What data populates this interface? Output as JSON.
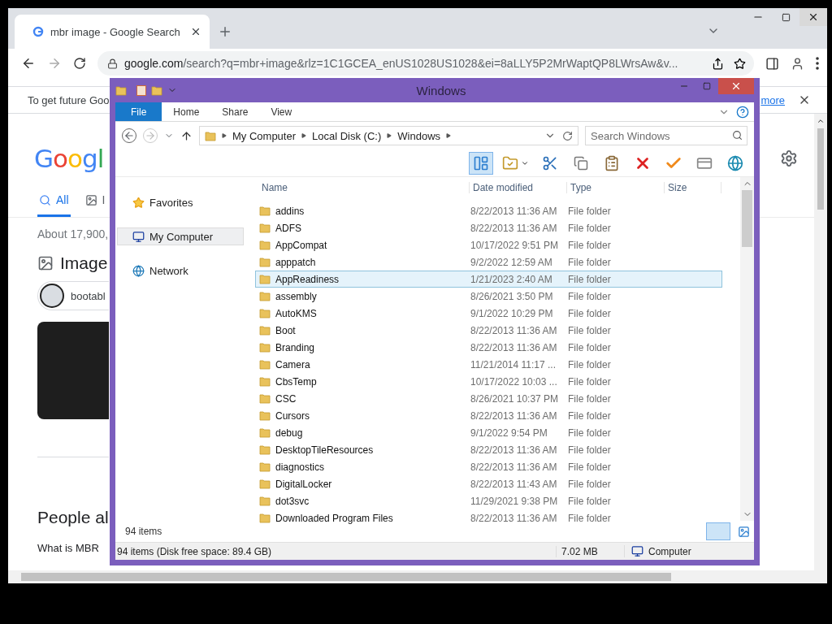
{
  "browser": {
    "tabs": [
      {
        "title": "mbr image - Google Search",
        "selected": true
      }
    ],
    "url": {
      "host": "google.com",
      "path": "/search?q=mbr+image&rlz=1C1GCEA_enUS1028US1028&ei=8aLLY5P2MrWaptQP8LWrsAw&v..."
    },
    "infobar": {
      "text": "To get future Goo",
      "link": "more"
    },
    "page": {
      "logo": "Googl",
      "tabs": [
        {
          "label": "All",
          "kind": "all",
          "selected": true
        },
        {
          "label": "I",
          "kind": "images",
          "selected": false
        }
      ],
      "result_stats": "About 17,900,",
      "images_heading": "Image",
      "chip": "bootabl",
      "people_heading": "People al",
      "question": "What is MBR"
    }
  },
  "explorer": {
    "title": "Windows",
    "ribbon_tabs": [
      {
        "label": "File",
        "kind": "menu"
      },
      {
        "label": "Home",
        "kind": "tab"
      },
      {
        "label": "Share",
        "kind": "tab"
      },
      {
        "label": "View",
        "kind": "tab"
      }
    ],
    "breadcrumb": [
      "My Computer",
      "Local Disk (C:)",
      "Windows"
    ],
    "search": {
      "placeholder": "Search Windows"
    },
    "nav": [
      {
        "label": "Favorites",
        "kind": "favorites",
        "selected": false
      },
      {
        "label": "My Computer",
        "kind": "computer",
        "selected": true
      },
      {
        "label": "Network",
        "kind": "network",
        "selected": false
      }
    ],
    "nav_count": "94 items",
    "columns": [
      "Name",
      "Date modified",
      "Type",
      "Size"
    ],
    "rows": [
      {
        "name": "addins",
        "date": "8/22/2013 11:36 AM",
        "type": "File folder",
        "selected": false
      },
      {
        "name": "ADFS",
        "date": "8/22/2013 11:36 AM",
        "type": "File folder",
        "selected": false
      },
      {
        "name": "AppCompat",
        "date": "10/17/2022 9:51 PM",
        "type": "File folder",
        "selected": false
      },
      {
        "name": "apppatch",
        "date": "9/2/2022 12:59 AM",
        "type": "File folder",
        "selected": false
      },
      {
        "name": "AppReadiness",
        "date": "1/21/2023 2:40 AM",
        "type": "File folder",
        "selected": true
      },
      {
        "name": "assembly",
        "date": "8/26/2021 3:50 PM",
        "type": "File folder",
        "selected": false
      },
      {
        "name": "AutoKMS",
        "date": "9/1/2022 10:29 PM",
        "type": "File folder",
        "selected": false
      },
      {
        "name": "Boot",
        "date": "8/22/2013 11:36 AM",
        "type": "File folder",
        "selected": false
      },
      {
        "name": "Branding",
        "date": "8/22/2013 11:36 AM",
        "type": "File folder",
        "selected": false
      },
      {
        "name": "Camera",
        "date": "11/21/2014 11:17 ...",
        "type": "File folder",
        "selected": false
      },
      {
        "name": "CbsTemp",
        "date": "10/17/2022 10:03 ...",
        "type": "File folder",
        "selected": false
      },
      {
        "name": "CSC",
        "date": "8/26/2021 10:37 PM",
        "type": "File folder",
        "selected": false
      },
      {
        "name": "Cursors",
        "date": "8/22/2013 11:36 AM",
        "type": "File folder",
        "selected": false
      },
      {
        "name": "debug",
        "date": "9/1/2022 9:54 PM",
        "type": "File folder",
        "selected": false
      },
      {
        "name": "DesktopTileResources",
        "date": "8/22/2013 11:36 AM",
        "type": "File folder",
        "selected": false
      },
      {
        "name": "diagnostics",
        "date": "8/22/2013 11:36 AM",
        "type": "File folder",
        "selected": false
      },
      {
        "name": "DigitalLocker",
        "date": "8/22/2013 11:43 AM",
        "type": "File folder",
        "selected": false
      },
      {
        "name": "dot3svc",
        "date": "11/29/2021 9:38 PM",
        "type": "File folder",
        "selected": false
      },
      {
        "name": "Downloaded Program Files",
        "date": "8/22/2013 11:36 AM",
        "type": "File folder",
        "selected": false
      }
    ],
    "status": {
      "items": "94 items (Disk free space: 89.4 GB)",
      "size": "7.02 MB",
      "location": "Computer"
    }
  }
}
